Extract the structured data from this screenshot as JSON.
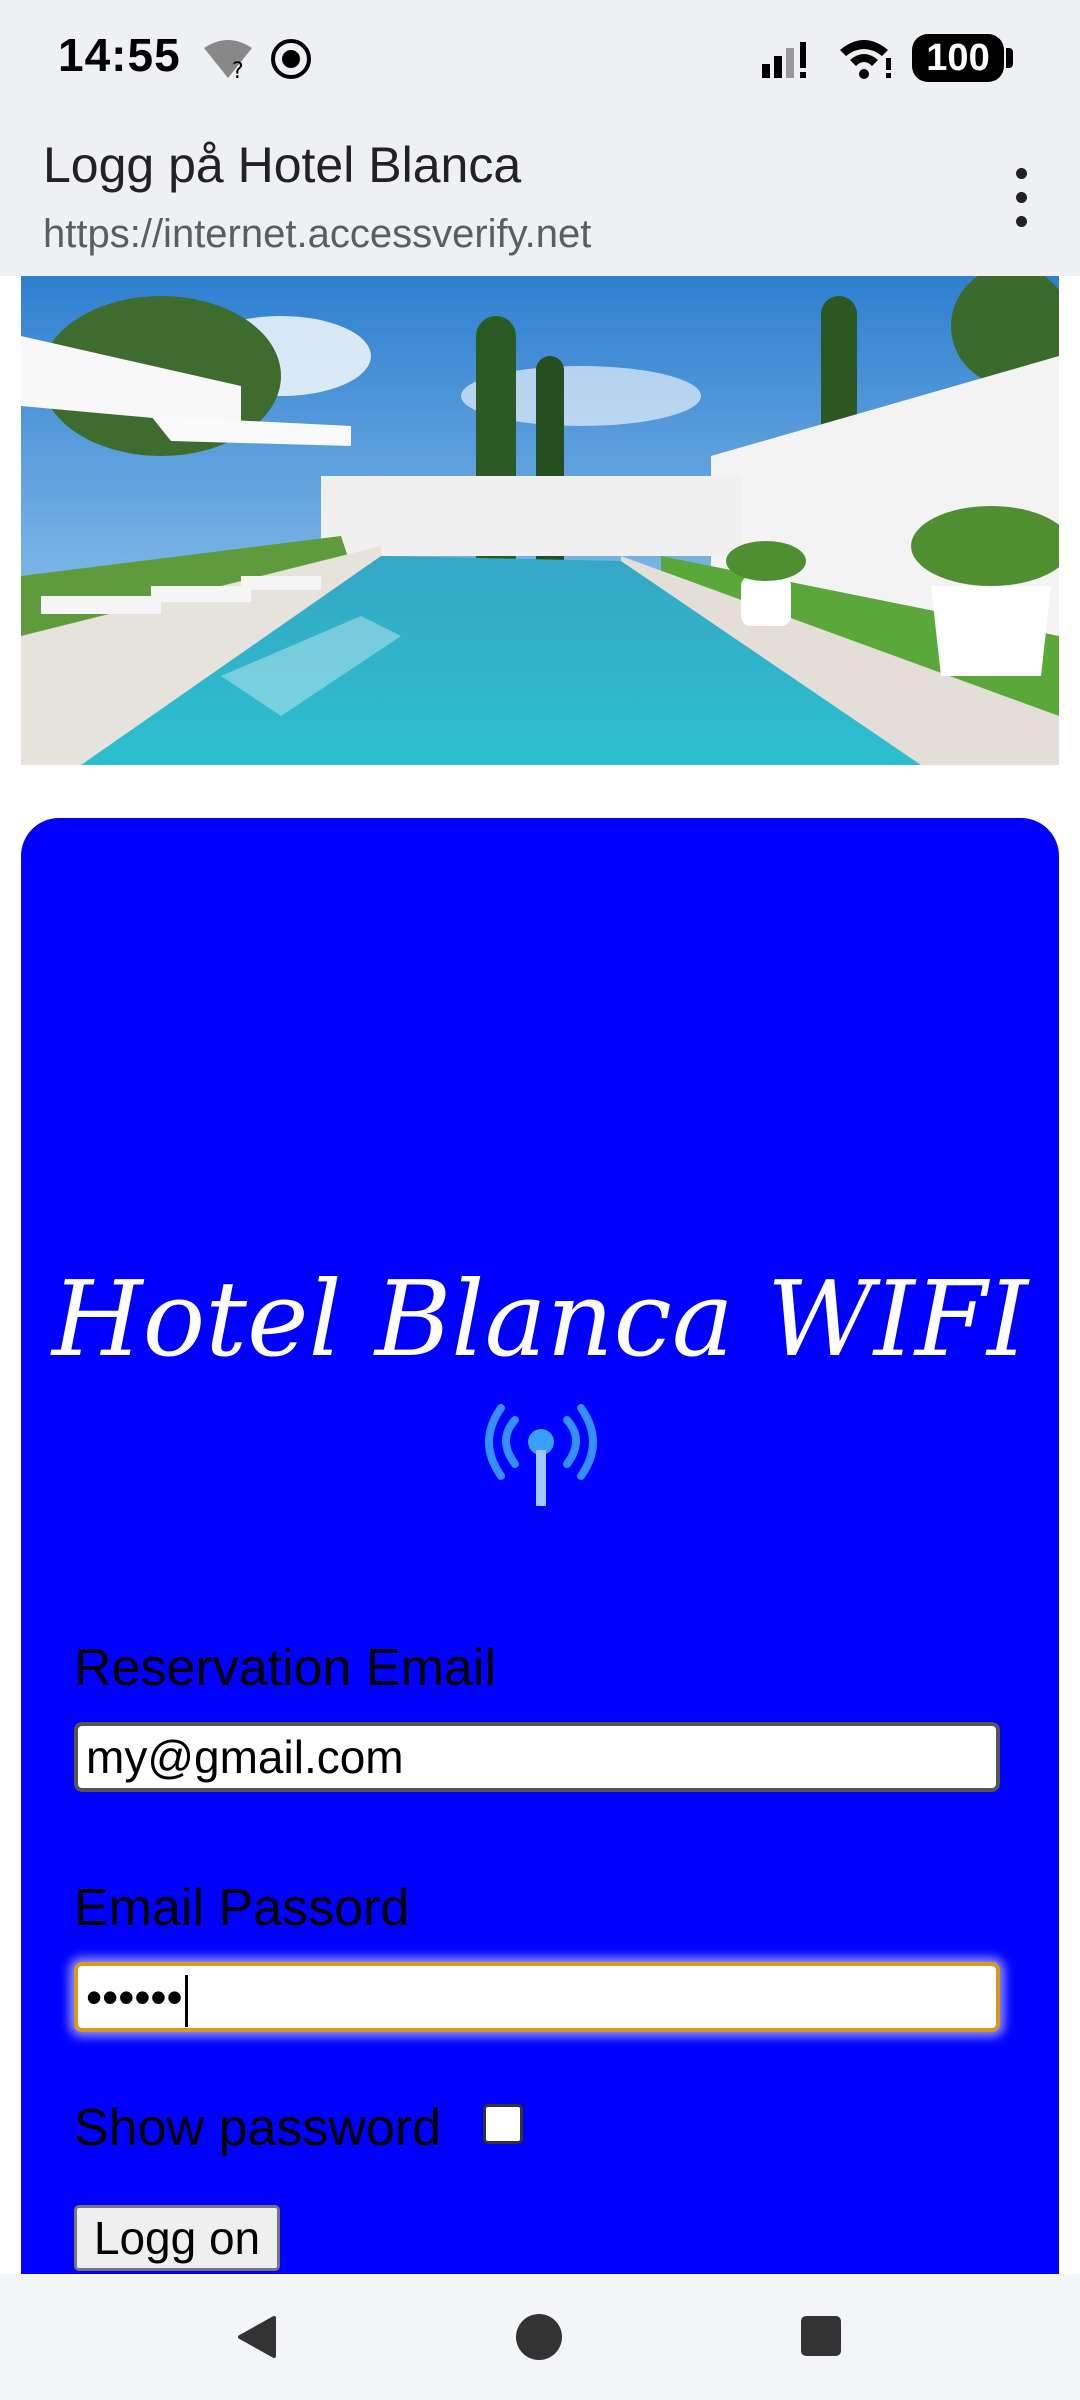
{
  "status_bar": {
    "time": "14:55",
    "battery": "100",
    "icons": [
      "wifi-unknown-icon",
      "vpn-icon",
      "signal-icon",
      "wifi-icon",
      "battery-icon"
    ]
  },
  "browser": {
    "title": "Logg på Hotel Blanca",
    "url": "https://internet.accessverify.net",
    "menu_icon": "more-vert-icon"
  },
  "hero": {
    "description_icon": "pool-photo"
  },
  "login": {
    "title": "Hotel Blanca WIFI",
    "antenna_icon": "antenna-icon",
    "email_label": "Reservation Email",
    "email_value": "my@gmail.com",
    "password_label": "Email Passord",
    "password_value": "••••••",
    "show_password_label": "Show password",
    "show_password_checked": false,
    "submit_label": "Logg on"
  },
  "colors": {
    "card_background": "#0000ff",
    "focus_border": "#d79a1c",
    "chrome_background": "#eef0f3"
  },
  "nav": {
    "icons": [
      "back-icon",
      "home-icon",
      "recents-icon"
    ]
  }
}
